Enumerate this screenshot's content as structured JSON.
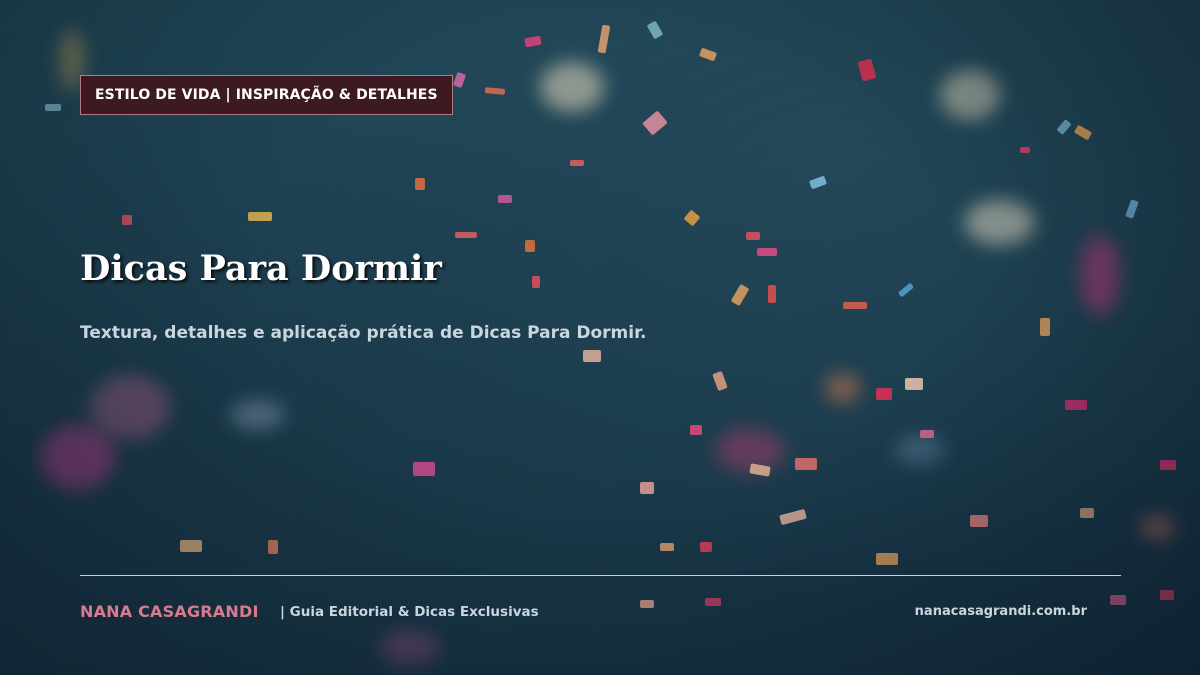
{
  "badge": {
    "label": "ESTILO DE VIDA | INSPIRAÇÃO & DETALHES"
  },
  "hero": {
    "title": "Dicas Para Dormir",
    "subtitle": "Textura, detalhes e aplicação prática de Dicas Para Dormir."
  },
  "footer": {
    "brand": "NANA CASAGRANDI",
    "tagline": "|  Guia Editorial & Dicas Exclusivas",
    "site": "nanacasagrandi.com.br"
  },
  "colors": {
    "badge_bg": "#3d1a22",
    "brand_pink": "#d97a91",
    "background": "#1d3d4f",
    "text_light": "#c9d6de"
  }
}
